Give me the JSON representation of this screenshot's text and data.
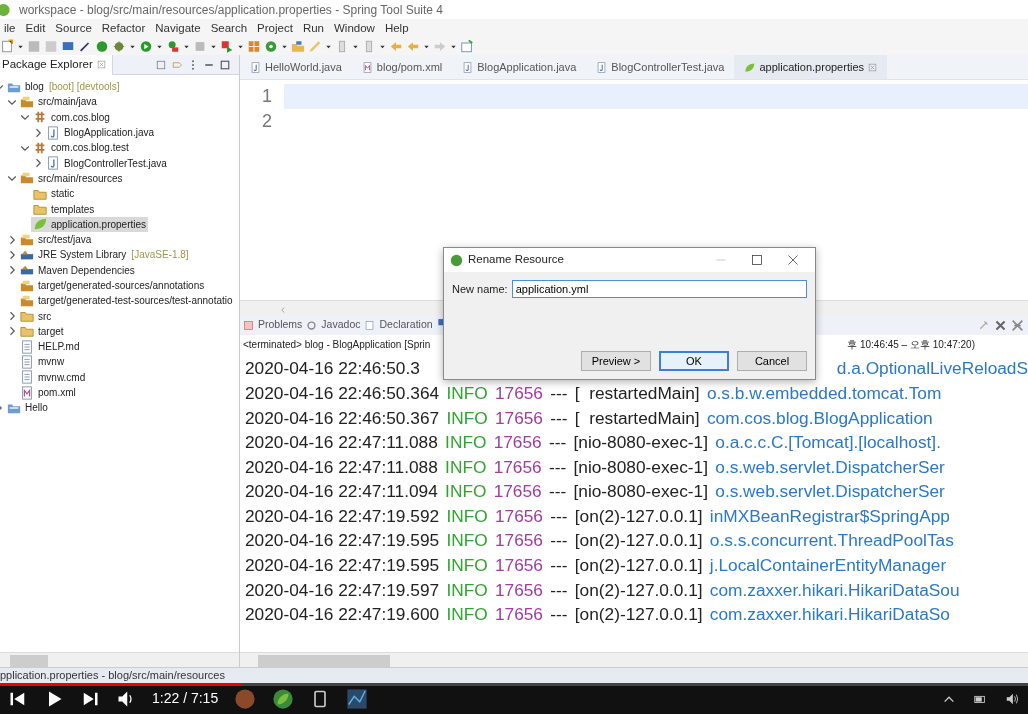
{
  "window": {
    "title": "workspace - blog/src/main/resources/application.properties - Spring Tool Suite 4"
  },
  "menu": [
    "ile",
    "Edit",
    "Source",
    "Refactor",
    "Navigate",
    "Search",
    "Project",
    "Run",
    "Window",
    "Help"
  ],
  "explorer": {
    "title": "Package Explorer",
    "tree": [
      {
        "label": "blog",
        "decoration": "[boot] [devtools]",
        "kind": "project",
        "expanded": true,
        "selected": false,
        "children": [
          {
            "label": "src/main/java",
            "kind": "source-folder",
            "expanded": true,
            "selected": false,
            "children": [
              {
                "label": "com.cos.blog",
                "kind": "package",
                "expanded": true,
                "selected": false,
                "children": [
                  {
                    "label": "BlogApplication.java",
                    "kind": "java",
                    "expanded": false,
                    "selected": false
                  }
                ]
              },
              {
                "label": "com.cos.blog.test",
                "kind": "package",
                "expanded": true,
                "selected": false,
                "children": [
                  {
                    "label": "BlogControllerTest.java",
                    "kind": "java",
                    "expanded": false,
                    "selected": false
                  }
                ]
              }
            ]
          },
          {
            "label": "src/main/resources",
            "kind": "source-folder",
            "expanded": true,
            "selected": false,
            "children": [
              {
                "label": "static",
                "kind": "folder",
                "selected": false
              },
              {
                "label": "templates",
                "kind": "folder",
                "selected": false
              },
              {
                "label": "application.properties",
                "kind": "properties",
                "selected": true
              }
            ]
          },
          {
            "label": "src/test/java",
            "kind": "source-folder",
            "expanded": false,
            "selected": false
          },
          {
            "label": "JRE System Library",
            "decoration": "[JavaSE-1.8]",
            "kind": "library",
            "expanded": false,
            "selected": false
          },
          {
            "label": "Maven Dependencies",
            "kind": "library",
            "expanded": false,
            "selected": false
          },
          {
            "label": "target/generated-sources/annotations",
            "kind": "source-folder",
            "selected": false
          },
          {
            "label": "target/generated-test-sources/test-annotatio",
            "kind": "source-folder",
            "selected": false
          },
          {
            "label": "src",
            "kind": "folder",
            "expanded": false,
            "selected": false
          },
          {
            "label": "target",
            "kind": "folder",
            "expanded": false,
            "selected": false
          },
          {
            "label": "HELP.md",
            "kind": "file",
            "selected": false
          },
          {
            "label": "mvnw",
            "kind": "file",
            "selected": false
          },
          {
            "label": "mvnw.cmd",
            "kind": "file",
            "selected": false
          },
          {
            "label": "pom.xml",
            "kind": "xml",
            "selected": false
          }
        ]
      },
      {
        "label": "Hello",
        "kind": "project",
        "expanded": false,
        "selected": false
      }
    ]
  },
  "editor": {
    "tabs": [
      {
        "label": "HelloWorld.java",
        "kind": "java",
        "selected": false
      },
      {
        "label": "blog/pom.xml",
        "kind": "xml",
        "selected": false
      },
      {
        "label": "BlogApplication.java",
        "kind": "java",
        "selected": false
      },
      {
        "label": "BlogControllerTest.java",
        "kind": "java",
        "selected": false
      },
      {
        "label": "application.properties",
        "kind": "properties",
        "selected": true
      }
    ],
    "line_numbers": [
      "1",
      "2"
    ]
  },
  "console": {
    "tabs": [
      "Problems",
      "Javadoc",
      "Declaration"
    ],
    "header_left": "<terminated> blog - BlogApplication [Sprin",
    "header_right": "후 10:46:45 – 오후 10:47:20)",
    "rows": [
      {
        "timestamp": "2020-04-16 22:46:50.3",
        "logger": "d.a.OptionalLiveReloadS"
      },
      {
        "timestamp": "2020-04-16 22:46:50.364",
        "level": "INFO",
        "pid": "17656",
        "sep": "---",
        "thread": "[  restartedMain]",
        "logger": "o.s.b.w.embedded.tomcat.Tom"
      },
      {
        "timestamp": "2020-04-16 22:46:50.367",
        "level": "INFO",
        "pid": "17656",
        "sep": "---",
        "thread": "[  restartedMain]",
        "logger": "com.cos.blog.BlogApplication"
      },
      {
        "timestamp": "2020-04-16 22:47:11.088",
        "level": "INFO",
        "pid": "17656",
        "sep": "---",
        "thread": "[nio-8080-exec-1]",
        "logger": "o.a.c.c.C.[Tomcat].[localhost]."
      },
      {
        "timestamp": "2020-04-16 22:47:11.088",
        "level": "INFO",
        "pid": "17656",
        "sep": "---",
        "thread": "[nio-8080-exec-1]",
        "logger": "o.s.web.servlet.DispatcherSer"
      },
      {
        "timestamp": "2020-04-16 22:47:11.094",
        "level": "INFO",
        "pid": "17656",
        "sep": "---",
        "thread": "[nio-8080-exec-1]",
        "logger": "o.s.web.servlet.DispatcherSer"
      },
      {
        "timestamp": "2020-04-16 22:47:19.592",
        "level": "INFO",
        "pid": "17656",
        "sep": "---",
        "thread": "[on(2)-127.0.0.1]",
        "logger": "inMXBeanRegistrar$SpringApp"
      },
      {
        "timestamp": "2020-04-16 22:47:19.595",
        "level": "INFO",
        "pid": "17656",
        "sep": "---",
        "thread": "[on(2)-127.0.0.1]",
        "logger": "o.s.s.concurrent.ThreadPoolTas"
      },
      {
        "timestamp": "2020-04-16 22:47:19.595",
        "level": "INFO",
        "pid": "17656",
        "sep": "---",
        "thread": "[on(2)-127.0.0.1]",
        "logger": "j.LocalContainerEntityManager"
      },
      {
        "timestamp": "2020-04-16 22:47:19.597",
        "level": "INFO",
        "pid": "17656",
        "sep": "---",
        "thread": "[on(2)-127.0.0.1]",
        "logger": "com.zaxxer.hikari.HikariDataSou"
      },
      {
        "timestamp": "2020-04-16 22:47:19.600",
        "level": "INFO",
        "pid": "17656",
        "sep": "---",
        "thread": "[on(2)-127.0.0.1]",
        "logger": "com.zaxxer.hikari.HikariDataSo"
      }
    ]
  },
  "dialog": {
    "title": "Rename Resource",
    "field_label": "New name:",
    "value": "application.yml",
    "buttons": [
      {
        "label": "Preview >",
        "default": false
      },
      {
        "label": "OK",
        "default": true
      },
      {
        "label": "Cancel",
        "default": false
      }
    ]
  },
  "status_bar": "pplication.properties - blog/src/main/resources",
  "video": {
    "level": 0.235,
    "time": "1:22 / 7:15"
  }
}
